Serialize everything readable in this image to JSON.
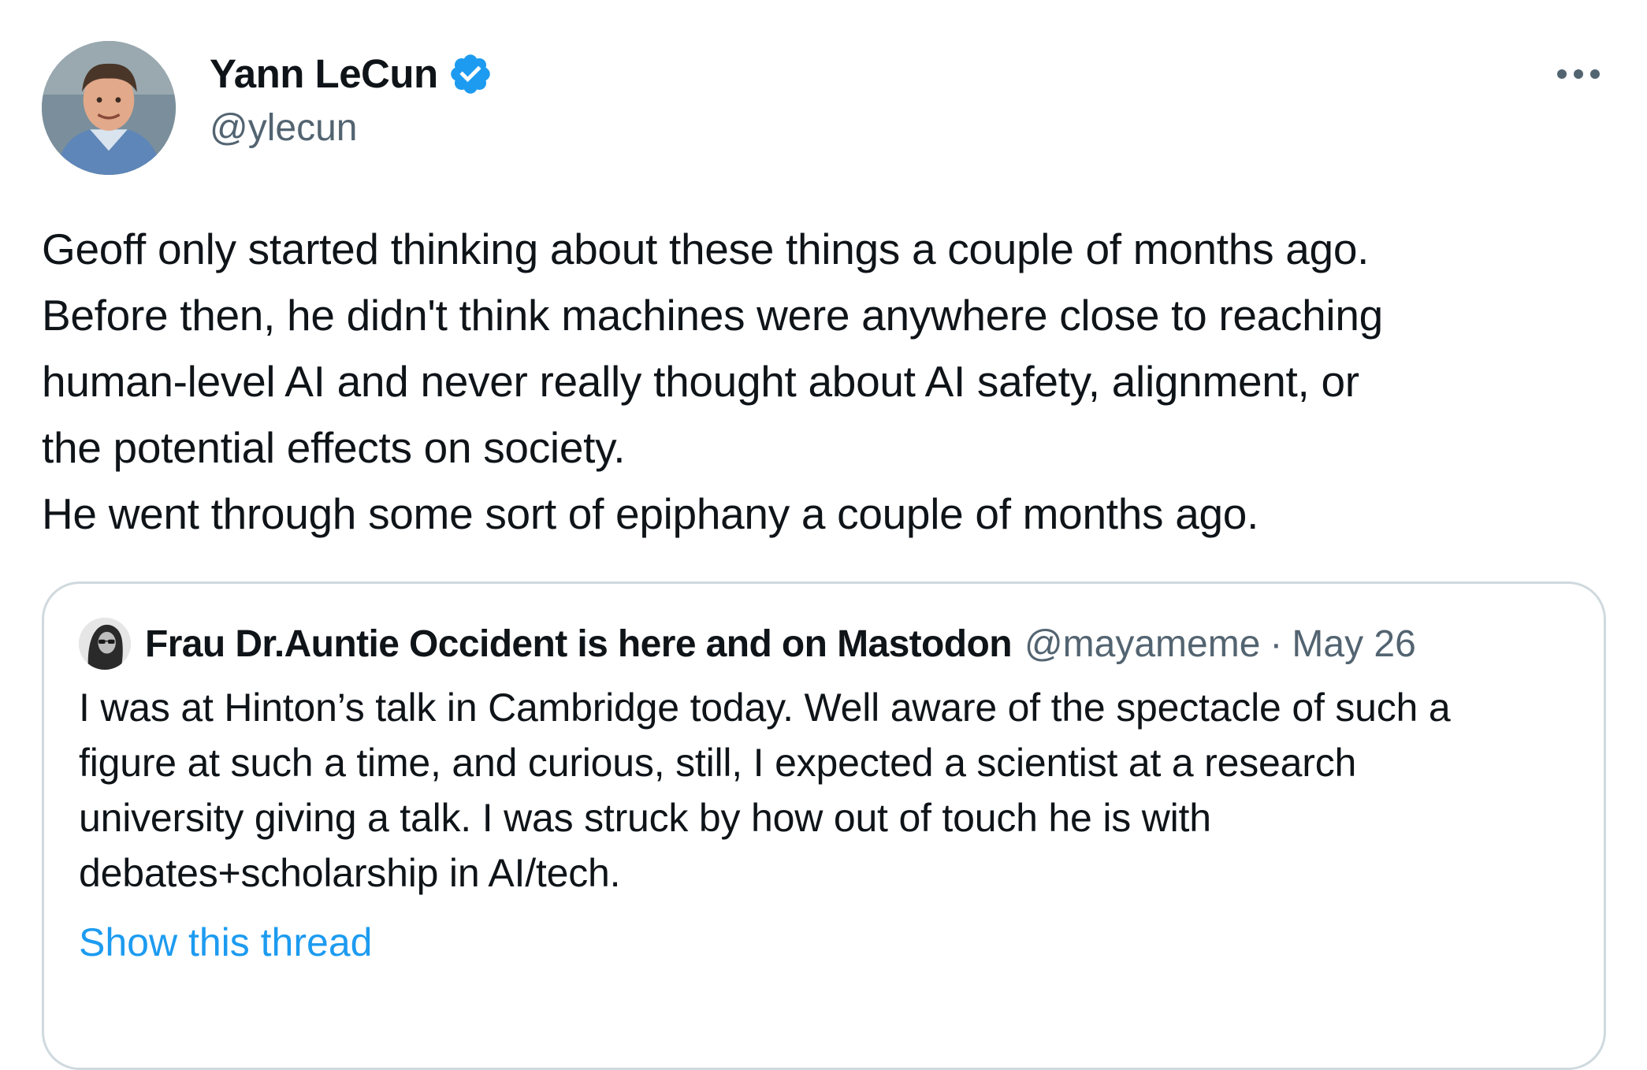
{
  "author": {
    "name": "Yann LeCun",
    "handle": "@ylecun",
    "verified": true
  },
  "tweet": {
    "lines": [
      "Geoff only started thinking about these things a couple of months ago.",
      "Before then, he didn't think machines were anywhere close to reaching",
      "human-level AI and never really thought about AI safety, alignment, or",
      "the potential effects on society.",
      "He went through some sort of epiphany a couple of months ago."
    ]
  },
  "quoted_tweet": {
    "author_name": "Frau Dr.Auntie Occident is here and on Mastodon",
    "handle": "@mayameme",
    "separator": "·",
    "date": "May 26",
    "lines": [
      "I was at Hinton’s talk in Cambridge today. Well aware of the spectacle of such a",
      "figure at such a time, and curious, still, I expected a scientist at a research",
      "university giving a talk. I was struck by how out of touch he is with",
      "debates+scholarship in AI/tech."
    ],
    "show_thread_label": "Show this thread"
  },
  "colors": {
    "text": "#0f1419",
    "secondary": "#536471",
    "link": "#1d9bf0",
    "verified_badge": "#1d9bf0",
    "card_border": "#cfd9de"
  },
  "icons": {
    "verified": "verified-badge-icon",
    "more": "more-options-icon"
  }
}
